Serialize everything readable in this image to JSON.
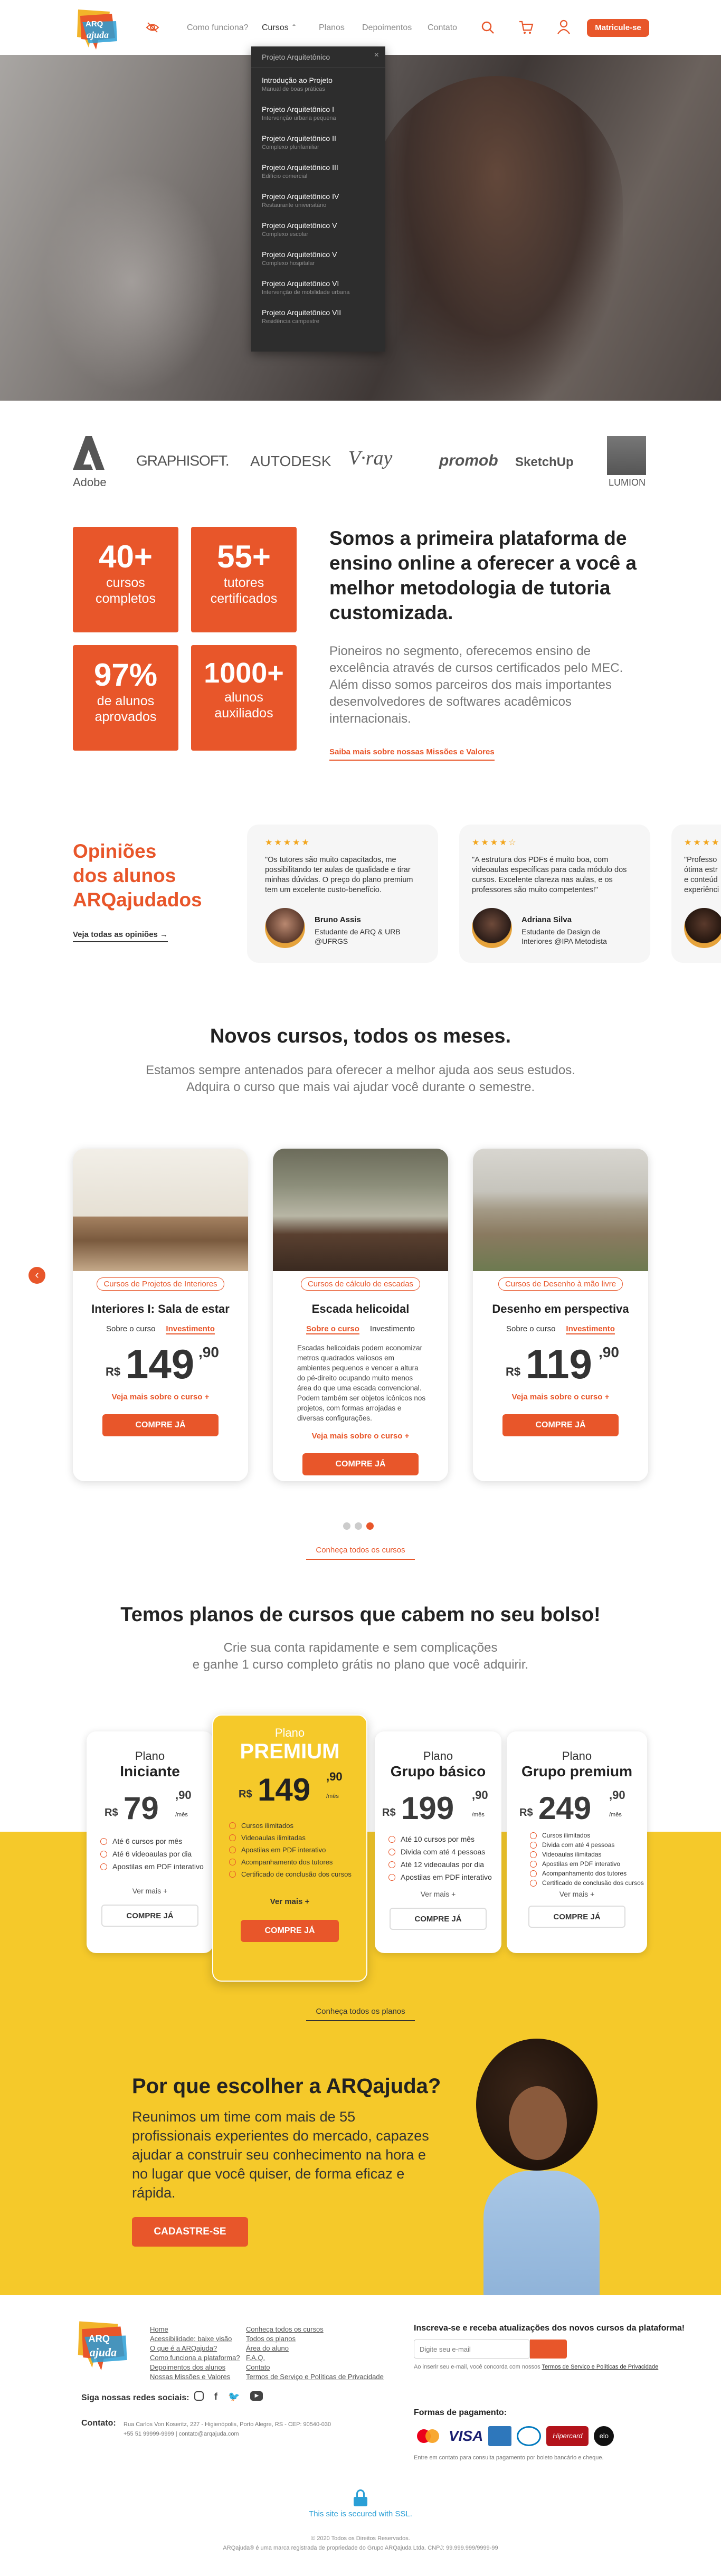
{
  "header": {
    "logo_text": "ARQ ajuda",
    "nav": [
      "Como funciona?",
      "Cursos",
      "Planos",
      "Depoimentos",
      "Contato"
    ],
    "cta": "Matricule-se"
  },
  "dropdown": {
    "title": "Projeto Arquitetônico",
    "items": [
      {
        "t": "Introdução ao Projeto",
        "s": "Manual de boas práticas"
      },
      {
        "t": "Projeto Arquitetônico I",
        "s": "Intervenção urbana pequena"
      },
      {
        "t": "Projeto Arquitetônico II",
        "s": "Complexo plurifamiliar"
      },
      {
        "t": "Projeto Arquitetônico III",
        "s": "Edifício comercial"
      },
      {
        "t": "Projeto Arquitetônico IV",
        "s": "Restaurante universitário"
      },
      {
        "t": "Projeto Arquitetônico V",
        "s": "Complexo escolar"
      },
      {
        "t": "Projeto Arquitetônico V",
        "s": "Complexo hospitalar"
      },
      {
        "t": "Projeto Arquitetônico VI",
        "s": "Intervenção de mobilidade urbana"
      },
      {
        "t": "Projeto Arquitetônico VII",
        "s": "Residência campestre"
      }
    ]
  },
  "partners": [
    "Adobe",
    "GRAPHISOFT.",
    "AUTODESK",
    "V·ray",
    "promob",
    "SketchUp",
    "LUMION"
  ],
  "stats": [
    {
      "n": "40+",
      "l1": "cursos",
      "l2": "completos"
    },
    {
      "n": "55+",
      "l1": "tutores",
      "l2": "certificados"
    },
    {
      "n": "97%",
      "l1": "de alunos",
      "l2": "aprovados"
    },
    {
      "n": "1000+",
      "l1": "alunos",
      "l2": "auxiliados"
    }
  ],
  "about": {
    "title": "Somos a primeira plataforma de ensino online a oferecer a você a melhor metodologia de tutoria customizada.",
    "body": "Pioneiros no segmento, oferecemos ensino de excelência através de cursos certificados pelo MEC. Além disso somos parceiros dos mais importantes desenvolvedores de softwares acadêmicos internacionais.",
    "link": "Saiba mais sobre nossas Missões e Valores"
  },
  "testimonials": {
    "title_l1": "Opiniões",
    "title_l2": "dos alunos",
    "title_l3": "ARQajudados",
    "link": "Veja todas as opiniões →",
    "items": [
      {
        "stars": "★★★★★",
        "text": "\"Os tutores são muito capacitados, me possibilitando ter aulas de qualidade e tirar minhas dúvidas. O preço do plano premium tem um excelente custo-benefício.",
        "name": "Bruno Assis",
        "role": "Estudante de ARQ & URB @UFRGS"
      },
      {
        "stars": "★★★★☆",
        "text": "\"A estrutura dos PDFs é muito boa, com videoaulas específicas para cada módulo dos cursos. Excelente clareza nas aulas, e os professores são muito competentes!\"",
        "name": "Adriana Silva",
        "role": "Estudante de Design de Interiores @IPA Metodista"
      },
      {
        "stars": "★★★★★",
        "text": "\"Professo ótima estr e conteúd experiênci",
        "name": "",
        "role": ""
      }
    ]
  },
  "courses": {
    "title": "Novos cursos, todos os meses.",
    "sub1": "Estamos sempre antenados para oferecer a melhor ajuda aos seus estudos.",
    "sub2": "Adquira o curso que mais vai ajudar você durante o semestre.",
    "tab1": "Sobre o curso",
    "tab2": "Investimento",
    "rs": "R$",
    "more": "Veja mais sobre o curso +",
    "buy": "COMPRE JÁ",
    "all": "Conheça todos os cursos",
    "items": [
      {
        "tag": "Cursos de Projetos de Interiores",
        "title": "Interiores I: Sala de estar",
        "price": "149",
        "cents": ",90",
        "desc": ""
      },
      {
        "tag": "Cursos de cálculo de escadas",
        "title": "Escada helicoidal",
        "price": "149",
        "cents": ",90",
        "desc": "Escadas helicoidais podem economizar metros quadrados valiosos em ambientes pequenos e vencer a altura do pé-direito ocupando muito menos área do que uma escada convencional. Podem também ser objetos icônicos nos projetos, com formas arrojadas e diversas configurações."
      },
      {
        "tag": "Cursos de Desenho à mão livre",
        "title": "Desenho em perspectiva",
        "price": "119",
        "cents": ",90",
        "desc": ""
      }
    ]
  },
  "plans": {
    "title": "Temos planos de cursos que cabem no seu bolso!",
    "sub1": "Crie sua conta rapidamente e sem complicações",
    "sub2": "e ganhe 1 curso completo grátis no plano que você adquirir.",
    "all": "Conheça todos os planos",
    "plano": "Plano",
    "mes": "/mês",
    "more": "Ver mais +",
    "buy": "COMPRE JÁ",
    "items": [
      {
        "name": "Iniciante",
        "price": "79",
        "cents": ",90",
        "f": [
          "Até 6 cursos por mês",
          "Até 6 videoaulas por dia",
          "Apostilas em PDF interativo"
        ]
      },
      {
        "name": "PREMIUM",
        "price": "149",
        "cents": ",90",
        "f": [
          "Cursos ilimitados",
          "Videoaulas ilimitadas",
          "Apostilas em PDF interativo",
          "Acompanhamento dos tutores",
          "Certificado de conclusão dos cursos"
        ]
      },
      {
        "name": "Grupo básico",
        "price": "199",
        "cents": ",90",
        "f": [
          "Até 10 cursos por mês",
          "Divida com até 4 pessoas",
          "Até 12 videoaulas por dia",
          "Apostilas em PDF interativo"
        ]
      },
      {
        "name": "Grupo premium",
        "price": "249",
        "cents": ",90",
        "f": [
          "Cursos ilimitados",
          "Divida com até 4 pessoas",
          "Videoaulas ilimitadas",
          "Apostilas em PDF interativo",
          "Acompanhamento dos tutores",
          "Certificado de conclusão dos cursos"
        ]
      }
    ]
  },
  "why": {
    "title": "Por que escolher a ARQajuda?",
    "body": "Reunimos um time com mais de 55 profissionais experientes do mercado, capazes ajudar a construir seu conhecimento na hora e no lugar que você quiser, de forma eficaz e rápida.",
    "cta": "CADASTRE-SE"
  },
  "footer": {
    "col1": [
      "Home",
      "Acessibilidade: baixe visão",
      "O que é a ARQajuda?",
      "Como funciona a plataforma?",
      "Depoimentos dos alunos",
      "Nossas Missões e Valores"
    ],
    "col2": [
      "Conheça todos os cursos",
      "Todos os planos",
      "Área do aluno",
      "F.A.Q.",
      "Contato",
      "Termos de Serviço e Políticas de Privacidade"
    ],
    "news_title": "Inscreva-se e receba atualizações dos novos cursos da plataforma!",
    "news_placeholder": "Digite seu e-mail",
    "news_note_pre": "Ao inserir seu e-mail, você concorda com nossos",
    "news_note_link": "Termos de Serviço e Políticas de Privacidade",
    "social_label": "Siga nossas redes sociais:",
    "contact_label": "Contato:",
    "contact_addr": "Rua Carlos Von Koseritz, 227 - Higienópolis, Porto Alegre, RS - CEP: 90540-030",
    "contact_phone": "+55 51 99999-9999 | contato@arqajuda.com",
    "pay_title": "Formas de pagamento:",
    "pay_note": "Entre em contato para consulta pagamento por boleto bancário e cheque.",
    "secure": "This site is secured with SSL.",
    "copy1": "© 2020 Todos os Direitos Reservados.",
    "copy2": "ARQajuda® é uma marca registrada de propriedade do Grupo ARQajuda Ltda. CNPJ: 99.999.999/9999-99"
  },
  "colors": {
    "accent": "#e8562a",
    "yellow": "#f5c92a"
  }
}
